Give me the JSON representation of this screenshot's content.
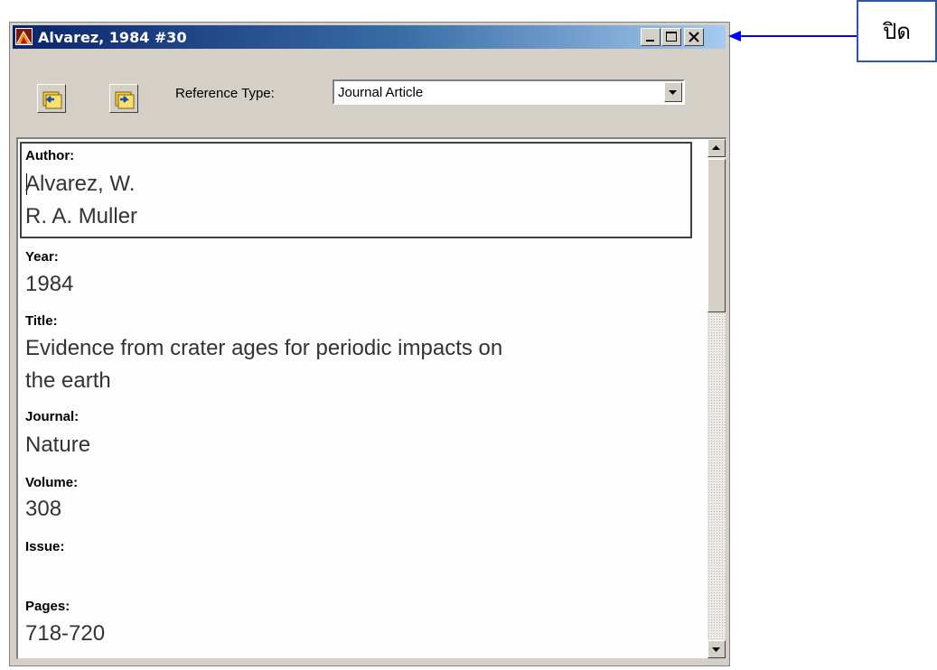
{
  "window": {
    "title": "Alvarez, 1984 #30",
    "icons": {
      "app": "endnote-app-icon",
      "minimize": "minimize-icon",
      "maximize": "maximize-icon",
      "close": "close-icon"
    }
  },
  "toolbar": {
    "prev_icon": "previous-reference-icon",
    "next_icon": "next-reference-icon",
    "reference_type_label": "Reference Type:",
    "reference_type_value": "Journal Article"
  },
  "fields": [
    {
      "label": "Author:",
      "values": [
        "Alvarez, W.",
        "R. A. Muller"
      ]
    },
    {
      "label": "Year:",
      "values": [
        "1984"
      ]
    },
    {
      "label": "Title:",
      "values": [
        "Evidence from crater ages for periodic impacts on",
        "the earth"
      ]
    },
    {
      "label": "Journal:",
      "values": [
        "Nature"
      ]
    },
    {
      "label": "Volume:",
      "values": [
        "308"
      ]
    },
    {
      "label": "Issue:",
      "values": []
    },
    {
      "label": "Pages:",
      "values": [
        "718-720"
      ]
    }
  ],
  "callout": {
    "text": "ปิด"
  },
  "colors": {
    "titlebar_start": "#0a246a",
    "titlebar_end": "#a6caf0",
    "window_face": "#d4d0c8",
    "callout_border": "#2f55a5",
    "arrow": "#0000ff"
  }
}
